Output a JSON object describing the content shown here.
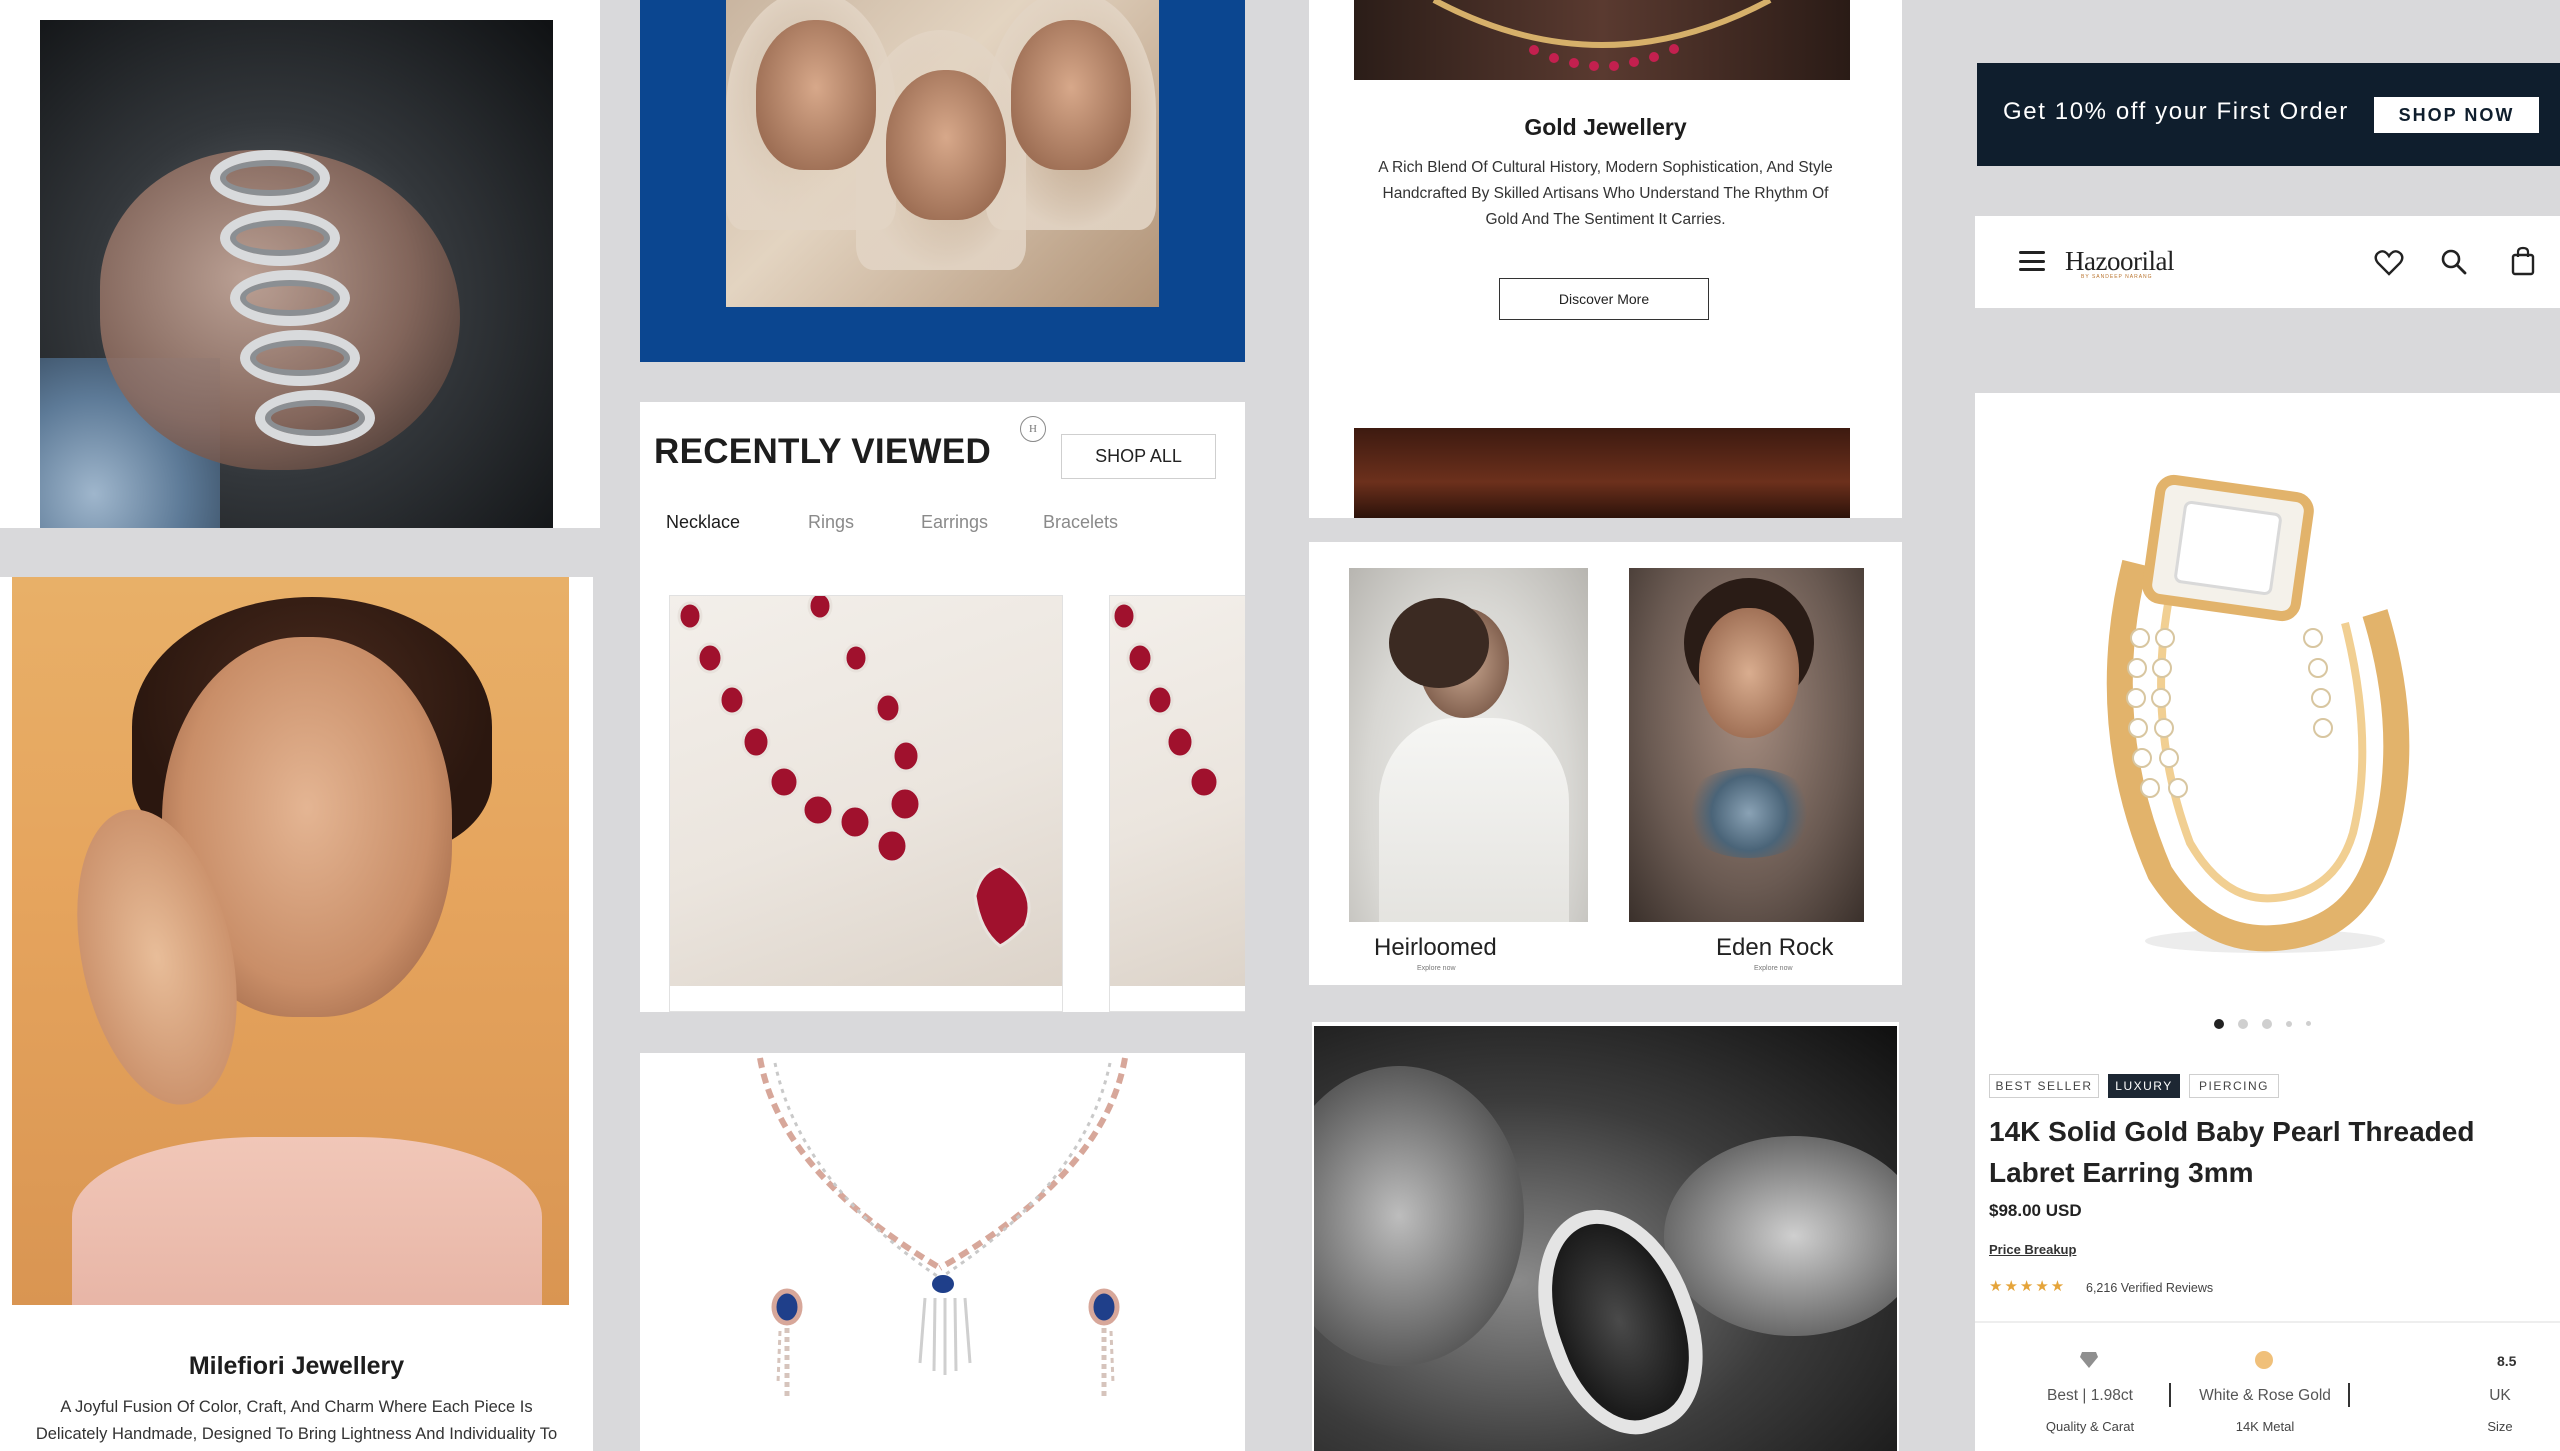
{
  "milefiori": {
    "title": "Milefiori Jewellery",
    "description_line1": "A Joyful Fusion Of Color, Craft, And Charm Where Each Piece Is",
    "description_line2": "Delicately Handmade, Designed To Bring Lightness And Individuality To"
  },
  "recently_viewed": {
    "title": "RECENTLY VIEWED",
    "shop_all_label": "SHOP ALL",
    "tabs": [
      "Necklace",
      "Rings",
      "Earrings",
      "Bracelets"
    ],
    "active_tab": "Necklace",
    "badge": "H"
  },
  "gold": {
    "title": "Gold Jewellery",
    "description": "A Rich Blend Of Cultural History, Modern Sophistication, And Style Handcrafted By Skilled Artisans Who Understand The Rhythm Of Gold And The Sentiment It Carries.",
    "cta_label": "Discover More"
  },
  "collections": [
    {
      "name": "Heirloomed",
      "sub": "Explore now"
    },
    {
      "name": "Eden Rock",
      "sub": "Explore now"
    }
  ],
  "promo": {
    "text": "Get 10% off your First Order",
    "button_label": "SHOP NOW"
  },
  "nav": {
    "logo": "Hazoorilal",
    "logo_sub": "BY SANDEEP NARANG"
  },
  "product": {
    "tags": [
      "BEST SELLER",
      "LUXURY",
      "PIERCING"
    ],
    "active_tag": "LUXURY",
    "title": "14K Solid Gold Baby Pearl Threaded Labret Earring 3mm",
    "price": "$98.00 USD",
    "price_breakup_label": "Price Breakup",
    "rating_stars": 5,
    "reviews": "6,216 Verified Reviews",
    "carousel": {
      "count": 5,
      "active": 1
    },
    "specs": [
      {
        "value": "Best | 1.98ct",
        "label": "Quality & Carat"
      },
      {
        "value": "White & Rose Gold",
        "label": "14K Metal"
      },
      {
        "value": "UK",
        "label": "Size",
        "top": "8.5"
      }
    ]
  },
  "colors": {
    "accent_blue": "#0b4690",
    "promo_dark": "#0f1e2d",
    "gold": "#e5a43a",
    "ruby": "#a0112d"
  }
}
